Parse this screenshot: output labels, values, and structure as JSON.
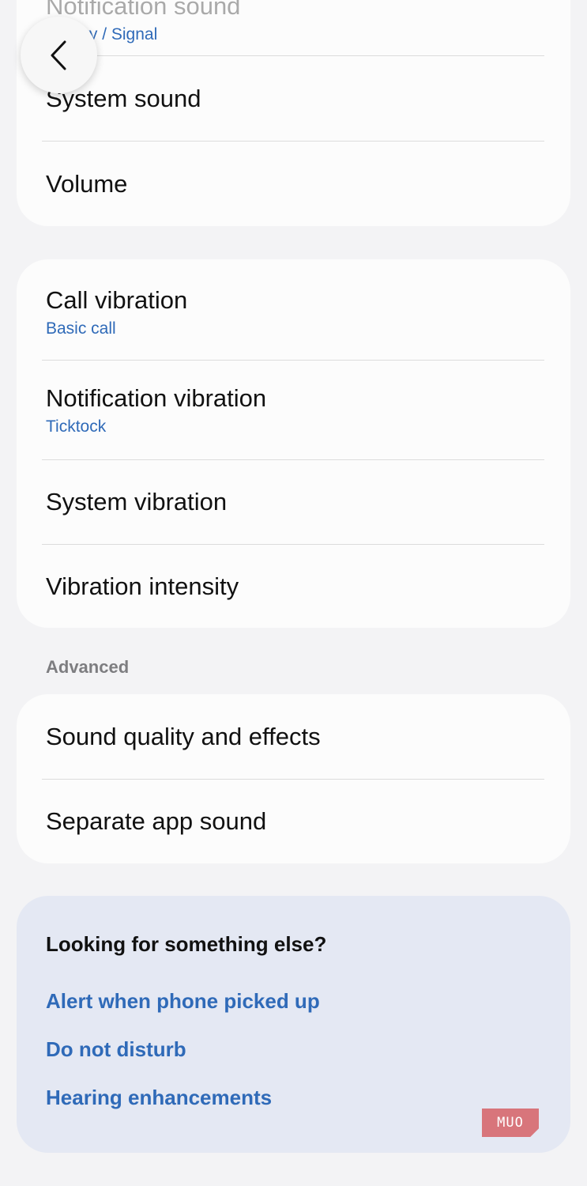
{
  "top_card": {
    "partial_title": "Notification sound",
    "partial_sub": "Galaxy / Signal",
    "items": [
      {
        "title": "System sound"
      },
      {
        "title": "Volume"
      }
    ]
  },
  "vibration_card": {
    "items": [
      {
        "title": "Call vibration",
        "sub": "Basic call"
      },
      {
        "title": "Notification vibration",
        "sub": "Ticktock"
      },
      {
        "title": "System vibration"
      },
      {
        "title": "Vibration intensity"
      }
    ]
  },
  "advanced": {
    "label": "Advanced",
    "items": [
      {
        "title": "Sound quality and effects"
      },
      {
        "title": "Separate app sound"
      }
    ]
  },
  "help": {
    "title": "Looking for something else?",
    "links": [
      "Alert when phone picked up",
      "Do not disturb",
      "Hearing enhancements"
    ]
  },
  "watermark": "MUO",
  "colors": {
    "background": "#f3f3f5",
    "card": "#fcfcfc",
    "accent": "#2f6ab8",
    "help_card": "#e4e8f3"
  },
  "icons": {
    "back": "chevron-left-icon"
  }
}
